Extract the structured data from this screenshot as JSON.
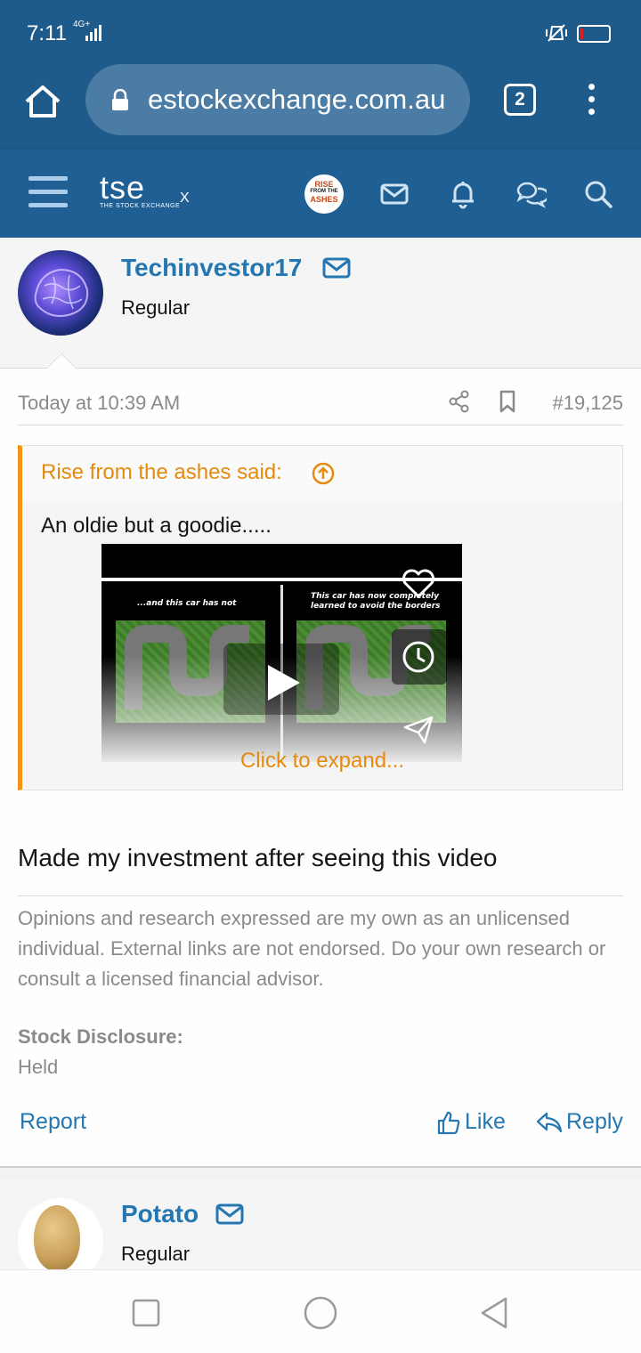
{
  "status_bar": {
    "time": "7:11",
    "network": "4G+",
    "battery_level": 0.1
  },
  "browser": {
    "url": "estockexchange.com.au",
    "tab_count": "2"
  },
  "site_header": {
    "logo_main": "tse",
    "logo_sub": "THE STOCK EXCHANGE",
    "logo_x": "X",
    "avatar_text_top": "RISE",
    "avatar_text_mid": "FROM THE",
    "avatar_text_bottom": "ASHES"
  },
  "post": {
    "username": "Techinvestor17",
    "user_title": "Regular",
    "date": "Today at 10:39 AM",
    "post_number": "#19,125",
    "quote": {
      "author_said": "Rise from the ashes said:",
      "text": "An oldie but a goodie.....",
      "video_caption_left": "...and this car has not",
      "video_caption_right": "This car has now completely learned to avoid the borders",
      "expand_label": "Click to expand..."
    },
    "message": "Made my investment after seeing this video",
    "signature": "Opinions and research expressed are my own as an unlicensed individual. External links are not endorsed. Do your own research or consult a licensed financial advisor.",
    "disclosure_label": "Stock Disclosure:",
    "disclosure_value": "Held",
    "actions": {
      "report": "Report",
      "like": "Like",
      "reply": "Reply"
    }
  },
  "next_post": {
    "username": "Potato",
    "user_title": "Regular"
  },
  "colors": {
    "header_blue": "#1e5a8a",
    "link_blue": "#2577b1",
    "quote_orange": "#f29514"
  }
}
